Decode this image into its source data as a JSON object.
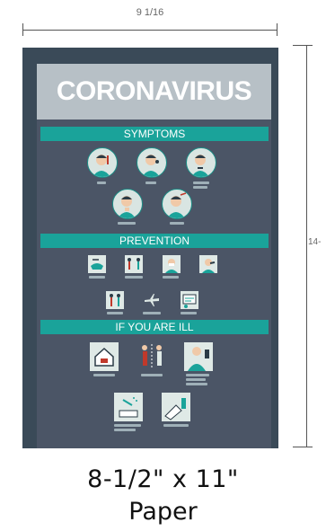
{
  "dimensions": {
    "width_label": "9 1/16",
    "height_label": "14-"
  },
  "poster": {
    "title": "CORONAVIRUS",
    "sections": [
      {
        "label": "SYMPTOMS"
      },
      {
        "label": "PREVENTION"
      },
      {
        "label": "IF YOU ARE ILL"
      }
    ]
  },
  "caption": {
    "size": "8-1/2\" x 11\"",
    "medium": "Paper"
  },
  "colors": {
    "board": "#3a4a58",
    "panel": "#4b5566",
    "accent": "#1aa39a",
    "title_box": "#b7c0c6"
  },
  "icons": [
    "fever-icon",
    "cough-icon",
    "breathing-icon",
    "sore-throat-icon",
    "headache-icon",
    "handwashing-icon",
    "distance-icon",
    "mask-icon",
    "cover-cough-icon",
    "no-handshake-icon",
    "no-travel-icon",
    "info-icon",
    "stay-home-icon",
    "isolate-icon",
    "call-doctor-icon",
    "disinfect-icon",
    "clean-icon"
  ]
}
